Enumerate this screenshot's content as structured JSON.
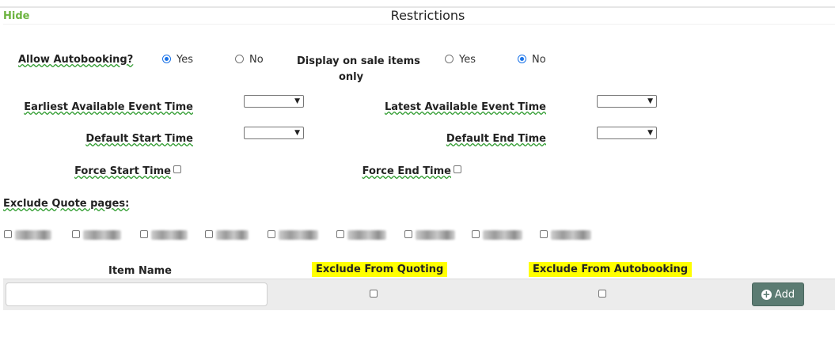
{
  "header": {
    "hide_label": "Hide",
    "title": "Restrictions"
  },
  "autobooking": {
    "label": "Allow Autobooking?",
    "options": [
      {
        "label": "Yes",
        "checked": true
      },
      {
        "label": "No",
        "checked": false
      }
    ]
  },
  "display_sale": {
    "label_line1": "Display on sale items",
    "label_line2": "only",
    "options": [
      {
        "label": "Yes",
        "checked": false
      },
      {
        "label": "No",
        "checked": true
      }
    ]
  },
  "times": {
    "earliest_label": "Earliest Available Event Time",
    "latest_label": "Latest Available Event Time",
    "default_start_label": "Default Start Time",
    "default_end_label": "Default End Time",
    "force_start_label": "Force Start Time",
    "force_end_label": "Force End Time"
  },
  "exclude_quote": {
    "label": "Exclude Quote pages:",
    "page_count": 9
  },
  "items_table": {
    "col_item_name": "Item Name",
    "col_exclude_quoting": "Exclude From Quoting",
    "col_exclude_autobooking": "Exclude From Autobooking",
    "item_name_value": "",
    "add_label": "Add",
    "add_icon": "plus-circle-icon"
  },
  "colors": {
    "link": "#6cb33f",
    "highlight": "#ffff00",
    "add_button": "#5b7b72",
    "radio_selected": "#1a73e8"
  }
}
